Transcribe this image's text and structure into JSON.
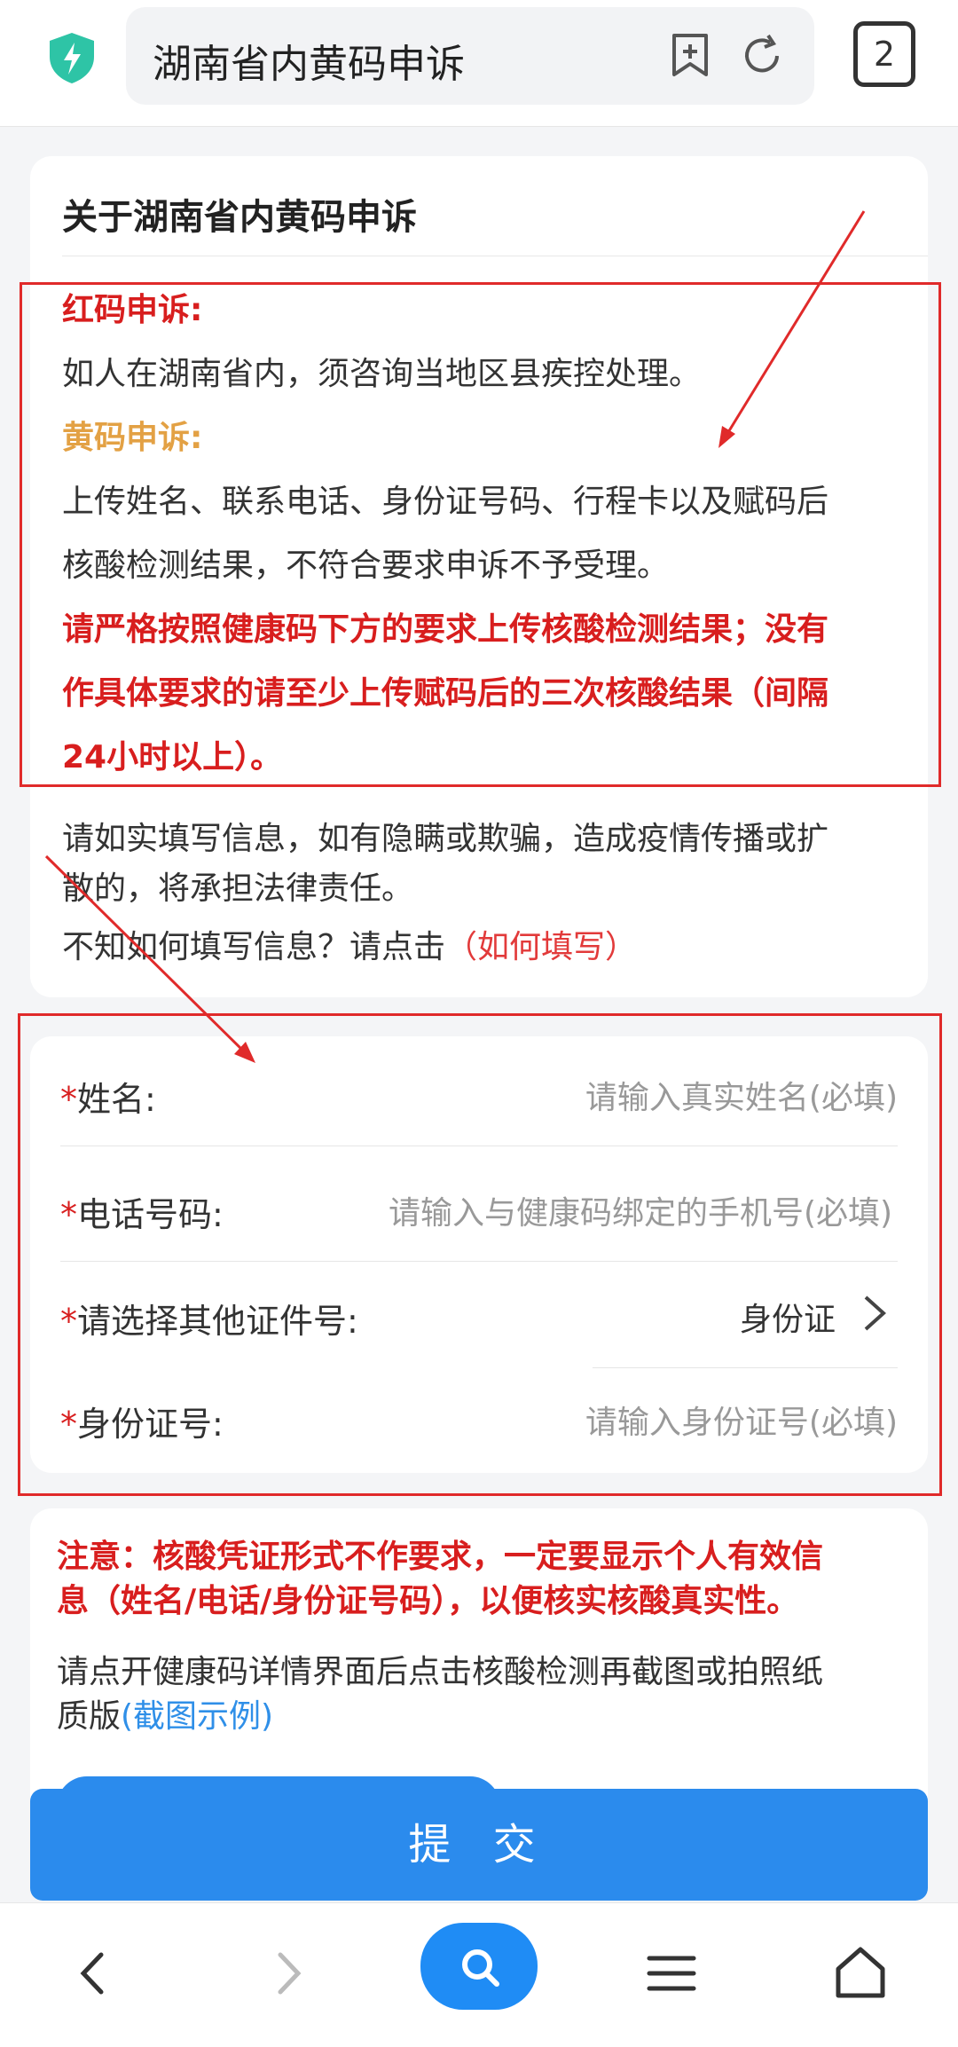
{
  "header": {
    "url_title": "湖南省内黄码申诉",
    "tab_count": "2"
  },
  "info": {
    "title": "关于湖南省内黄码申诉",
    "red_heading": "红码申诉:",
    "red_text": "如人在湖南省内，须咨询当地区县疾控处理。",
    "yellow_heading": "黄码申诉:",
    "yellow_text_1": "上传姓名、联系电话、身份证号码、行程卡以及赋码后",
    "yellow_text_2": "核酸检测结果，不符合要求申诉不予受理。",
    "strict_1": "请严格按照健康码下方的要求上传核酸检测结果；没有",
    "strict_2": "作具体要求的请至少上传赋码后的三次核酸结果（间隔",
    "strict_3": "24小时以上）。",
    "honesty_1": "请如实填写信息，如有隐瞒或欺骗，造成疫情传播或扩",
    "honesty_2": "散的，将承担法律责任。",
    "howto_prefix": "不知如何填写信息？请点击",
    "howto_link": "（如何填写）"
  },
  "form": {
    "name_label": "姓名:",
    "name_placeholder": "请输入真实姓名(必填)",
    "phone_label": "电话号码:",
    "phone_placeholder": "请输入与健康码绑定的手机号(必填)",
    "idtype_label": "请选择其他证件号:",
    "idtype_value": "身份证",
    "idnum_label": "身份证号:",
    "idnum_placeholder": "请输入身份证号(必填)",
    "required_mark": "*"
  },
  "note": {
    "warning_1": "注意：核酸凭证形式不作要求，一定要显示个人有效信",
    "warning_2": "息（姓名/电话/身份证号码），以便核实核酸真实性。",
    "instr_1": "请点开健康码详情界面后点击核酸检测再截图或拍照纸",
    "instr_2_prefix": "质版",
    "instr_2_link": "(截图示例)"
  },
  "actions": {
    "submit_label": "提 交"
  },
  "icons": {
    "shield": "shield-icon",
    "bookmark": "bookmark-add-icon",
    "reload": "reload-icon",
    "back": "back-icon",
    "forward": "forward-icon",
    "search": "search-icon",
    "menu": "menu-icon",
    "home": "home-icon"
  },
  "colors": {
    "accent_blue": "#2b8bed",
    "red": "#d81e1e",
    "yellow": "#e3a144"
  }
}
